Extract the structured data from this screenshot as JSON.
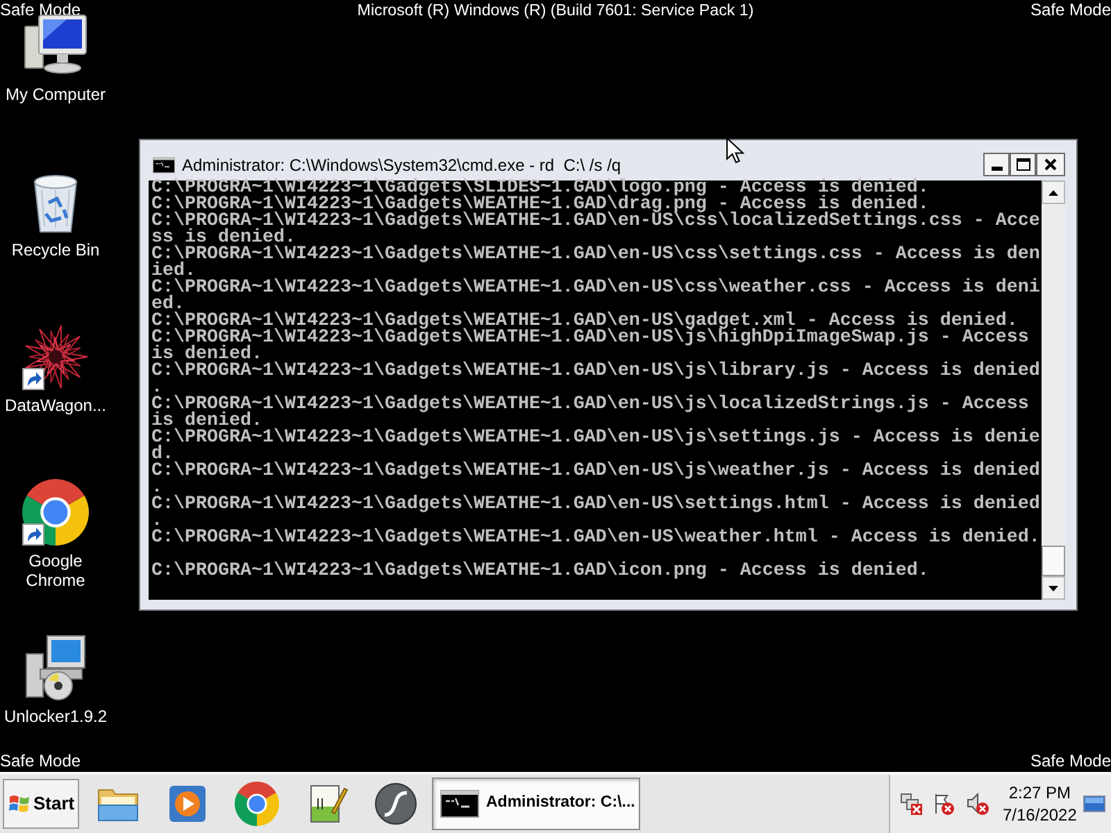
{
  "desktop_banner": {
    "top_left": "Safe Mode",
    "title": "Microsoft (R) Windows (R) (Build 7601: Service Pack 1)",
    "top_right": "Safe Mode",
    "bottom_left": "Safe Mode",
    "bottom_right": "Safe Mode"
  },
  "desktop_icons": [
    {
      "kind": "computer",
      "label": "My Computer",
      "shortcut": false
    },
    {
      "kind": "recycle_bin",
      "label": "Recycle Bin",
      "shortcut": false
    },
    {
      "kind": "starburst",
      "label": "DataWagon...",
      "shortcut": true
    },
    {
      "kind": "browser",
      "label": "Google Chrome",
      "shortcut": true
    },
    {
      "kind": "installer",
      "label": "Unlocker1.9.2",
      "shortcut": false
    }
  ],
  "console_window": {
    "title": "Administrator: C:\\Windows\\System32\\cmd.exe - rd  C:\\ /s /q",
    "output": [
      "C:\\PROGRA~1\\WI4223~1\\Gadgets\\SLIDES~1.GAD\\logo.png - Access is denied.",
      "C:\\PROGRA~1\\WI4223~1\\Gadgets\\WEATHE~1.GAD\\drag.png - Access is denied.",
      "C:\\PROGRA~1\\WI4223~1\\Gadgets\\WEATHE~1.GAD\\en-US\\css\\localizedSettings.css - Access is denied.",
      "C:\\PROGRA~1\\WI4223~1\\Gadgets\\WEATHE~1.GAD\\en-US\\css\\settings.css - Access is denied.",
      "C:\\PROGRA~1\\WI4223~1\\Gadgets\\WEATHE~1.GAD\\en-US\\css\\weather.css - Access is denied.",
      "C:\\PROGRA~1\\WI4223~1\\Gadgets\\WEATHE~1.GAD\\en-US\\gadget.xml - Access is denied.",
      "C:\\PROGRA~1\\WI4223~1\\Gadgets\\WEATHE~1.GAD\\en-US\\js\\highDpiImageSwap.js - Access is denied.",
      "C:\\PROGRA~1\\WI4223~1\\Gadgets\\WEATHE~1.GAD\\en-US\\js\\library.js - Access is denied.",
      "C:\\PROGRA~1\\WI4223~1\\Gadgets\\WEATHE~1.GAD\\en-US\\js\\localizedStrings.js - Access is denied.",
      "C:\\PROGRA~1\\WI4223~1\\Gadgets\\WEATHE~1.GAD\\en-US\\js\\settings.js - Access is denied.",
      "C:\\PROGRA~1\\WI4223~1\\Gadgets\\WEATHE~1.GAD\\en-US\\js\\weather.js - Access is denied.",
      "C:\\PROGRA~1\\WI4223~1\\Gadgets\\WEATHE~1.GAD\\en-US\\settings.html - Access is denied.",
      "C:\\PROGRA~1\\WI4223~1\\Gadgets\\WEATHE~1.GAD\\en-US\\weather.html - Access is denied.",
      "C:\\PROGRA~1\\WI4223~1\\Gadgets\\WEATHE~1.GAD\\icon.png - Access is denied."
    ]
  },
  "taskbar": {
    "start_label": "Start",
    "tasks": [
      {
        "label": "Administrator: C:\\...",
        "selected": true
      }
    ],
    "clock": {
      "time": "2:27 PM",
      "date": "7/16/2022"
    }
  }
}
